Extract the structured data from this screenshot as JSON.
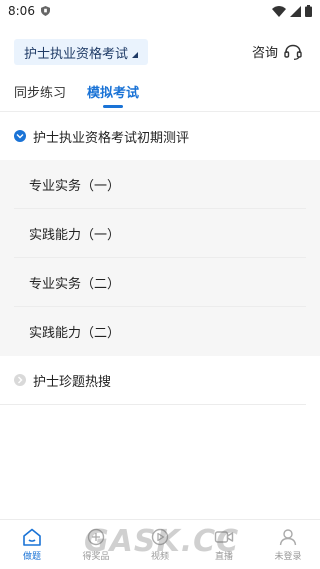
{
  "status_bar": {
    "time": "8:06"
  },
  "header": {
    "exam_selector": "护士执业资格考试",
    "consult_label": "咨询"
  },
  "tabs": [
    {
      "label": "同步练习",
      "active": false
    },
    {
      "label": "模拟考试",
      "active": true
    }
  ],
  "sections": [
    {
      "title": "护士执业资格考试初期测评",
      "expanded": true,
      "items": [
        "专业实务（一）",
        "实践能力（一）",
        "专业实务（二）",
        "实践能力（二）"
      ]
    },
    {
      "title": "护士珍题热搜",
      "expanded": false,
      "items": []
    }
  ],
  "bottom_nav": [
    {
      "label": "做题",
      "icon": "home-icon",
      "active": true
    },
    {
      "label": "得奖品",
      "icon": "gift-icon",
      "active": false
    },
    {
      "label": "视频",
      "icon": "play-icon",
      "active": false
    },
    {
      "label": "直播",
      "icon": "video-icon",
      "active": false
    },
    {
      "label": "未登录",
      "icon": "user-icon",
      "active": false
    }
  ],
  "watermark": "GASK.CC",
  "colors": {
    "accent": "#1a73d6",
    "selector_bg": "#eaf3fd",
    "sub_bg": "#f6f6f6"
  }
}
